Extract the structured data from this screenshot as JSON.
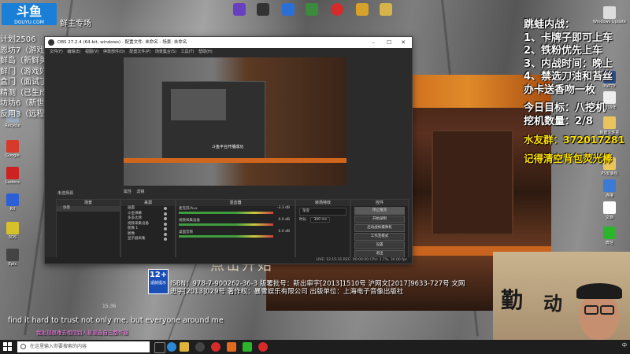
{
  "stream_overlay": {
    "logo_main": "斗鱼",
    "logo_sub": "DOUYU.COM",
    "room_text": "鲜主专场",
    "left_list": [
      "计划2506",
      "恩坊7（游戏下载）",
      "鲜岛（新鲜美)",
      "鲜门（游戏好）",
      "盒门（面试了)",
      "精测（已生成文）",
      "坊坊6（新世代了)",
      "反用3（远程中心)"
    ],
    "right_panel": {
      "lines": [
        "跳蛙内战：",
        "1、卡牌子即可上车",
        "2、铁粉优先上车",
        "3、内战时间：晚上",
        "4、禁选刀油和苔丝",
        "办卡送香吻一枚"
      ],
      "goal_lines": [
        "今日目标：八挖机",
        "挖机数量：2/8"
      ],
      "fan_group": "水友群：372017281",
      "reminder": "记得清空背包荧光棒"
    },
    "subtitle_en": "find it hard to trust not only me, but everyone around me",
    "subtitle_cn": "我发现很难去相信别人甚至连自己都怀疑",
    "game_center_text": "点击开始",
    "isbn_text": "ISBN：978-7-900262-36-3 版署批号：新出审字[2013]1510号 沪网文[2017]9633-727号 文网进字[2013]029号 著作权：暴雪娱乐有限公司 出版单位：上海电子音像出版社",
    "age_badge": "12+",
    "age_badge_sub": "适龄提示",
    "timecode": "15:36"
  },
  "desktop": {
    "top_icons": [
      {
        "name": "vs-icon",
        "color": "#6a3fbf"
      },
      {
        "name": "app-icon-2",
        "color": "#333333"
      },
      {
        "name": "app-icon-3",
        "color": "#2b6fd6"
      },
      {
        "name": "app-icon-4",
        "color": "#3c8a3c"
      },
      {
        "name": "netease-icon",
        "color": "#d62b2b"
      },
      {
        "name": "app-icon-6",
        "color": "#d6a22b"
      },
      {
        "name": "folder-icon",
        "color": "#d6b44a"
      }
    ],
    "left_icons": [
      "Recycle",
      "Google",
      "Ludens",
      "Kit",
      "3DS",
      "Epic"
    ],
    "right_icons": [
      "Windows Update",
      "PuTTY",
      "2019年",
      "新建文件夹",
      "PS安装包",
      "连接",
      "文档",
      "微信",
      "企业"
    ]
  },
  "obs": {
    "title": "OBS 27.2.4 (64-bit, windows) - 配置文件: 未命名 - 场景: 未命名",
    "menu": [
      "文件(F)",
      "编辑(E)",
      "视图(V)",
      "停靠部件(D)",
      "配置文件(P)",
      "场景集合(S)",
      "工具(T)",
      "帮助(H)"
    ],
    "source_label": "未选择源",
    "ctrl_buttons": [
      "属性",
      "滤镜"
    ],
    "docks": {
      "scenes": {
        "title": "场景",
        "items": [
          "场景"
        ]
      },
      "sources": {
        "title": "来源",
        "items": [
          "画面",
          "斗鱼弹幕",
          "多多太牌",
          "视频采集设备",
          "图像 1",
          "图像",
          "显示器采集"
        ]
      },
      "mixer": {
        "title": "混音器",
        "rows": [
          {
            "label": "麦克风/Aux",
            "level": "-3.3 dB"
          },
          {
            "label": "视频采集设备",
            "level": "0.0 dB"
          },
          {
            "label": "桌面音频",
            "level": "0.0 dB"
          }
        ]
      },
      "transitions": {
        "title": "转场特效",
        "type": "渐变",
        "duration_label": "时长",
        "duration": "300 ms"
      },
      "controls": {
        "title": "控件",
        "buttons": [
          "停止推流",
          "开始录制",
          "启动虚拟摄像机",
          "工作室模式",
          "设置",
          "退出"
        ]
      }
    },
    "status": "LIVE: 12:15:31   REC: 00:00:00   CPU: 1.7%, 30.00 fps",
    "preview_text": "斗鱼平台开播成功"
  },
  "taskbar": {
    "search_placeholder": "在这里输入你要搜索的内容",
    "tray_text": "中"
  }
}
